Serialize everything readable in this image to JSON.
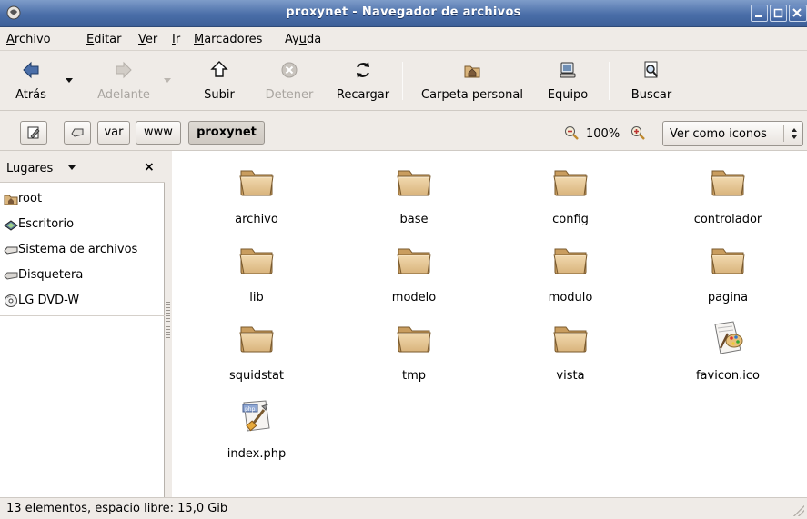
{
  "window": {
    "title": "proxynet - Navegador de archivos"
  },
  "menubar": {
    "items": [
      {
        "label": "Archivo",
        "mnemonic": "A"
      },
      {
        "label": "Editar",
        "mnemonic": "E"
      },
      {
        "label": "Ver",
        "mnemonic": "V"
      },
      {
        "label": "Ir",
        "mnemonic": "I"
      },
      {
        "label": "Marcadores",
        "mnemonic": "M"
      },
      {
        "label": "Ayuda",
        "mnemonic": "u"
      }
    ]
  },
  "toolbar": {
    "back": "Atrás",
    "forward": "Adelante",
    "up": "Subir",
    "stop": "Detener",
    "reload": "Recargar",
    "home": "Carpeta personal",
    "computer": "Equipo",
    "search": "Buscar"
  },
  "locationbar": {
    "path": [
      "var",
      "www",
      "proxynet"
    ],
    "zoom": "100%",
    "view_mode": "Ver como iconos"
  },
  "sidebar": {
    "title": "Lugares",
    "close": "×",
    "items": [
      {
        "label": "root",
        "icon": "home-folder-icon"
      },
      {
        "label": "Escritorio",
        "icon": "desktop-icon"
      },
      {
        "label": "Sistema de archivos",
        "icon": "drive-icon"
      },
      {
        "label": "Disquetera",
        "icon": "floppy-icon"
      },
      {
        "label": "LG DVD-W",
        "icon": "cdrom-icon"
      }
    ]
  },
  "files": [
    {
      "name": "archivo",
      "type": "folder"
    },
    {
      "name": "base",
      "type": "folder"
    },
    {
      "name": "config",
      "type": "folder"
    },
    {
      "name": "controlador",
      "type": "folder"
    },
    {
      "name": "lib",
      "type": "folder"
    },
    {
      "name": "modelo",
      "type": "folder"
    },
    {
      "name": "modulo",
      "type": "folder"
    },
    {
      "name": "pagina",
      "type": "folder"
    },
    {
      "name": "squidstat",
      "type": "folder"
    },
    {
      "name": "tmp",
      "type": "folder"
    },
    {
      "name": "vista",
      "type": "folder"
    },
    {
      "name": "favicon.ico",
      "type": "image"
    },
    {
      "name": "index.php",
      "type": "php"
    }
  ],
  "statusbar": {
    "text": "13 elementos, espacio libre: 15,0 Gib"
  },
  "colors": {
    "titlebar": "#4a6ea8",
    "folder": "#e6c48f",
    "folder_stroke": "#8c6a3a",
    "window_bg": "#efebe7"
  }
}
